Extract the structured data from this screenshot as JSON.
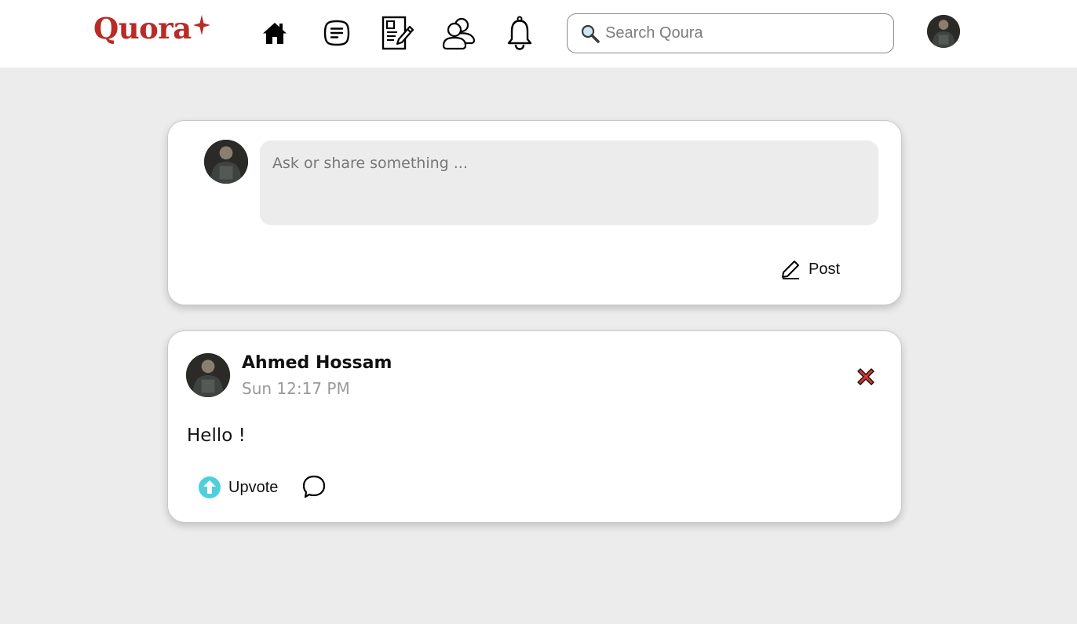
{
  "header": {
    "logo_text": "Quora",
    "nav_icons": [
      "home-icon",
      "answers-icon",
      "write-icon",
      "people-icon",
      "bell-icon"
    ],
    "search": {
      "placeholder": "Search Qoura",
      "value": ""
    },
    "brand_color": "#b92b27"
  },
  "composer": {
    "placeholder": "Ask or share something ...",
    "post_label": "Post"
  },
  "post": {
    "author": "Ahmed Hossam",
    "time": "Sun 12:17 PM",
    "text": "Hello !",
    "upvote_label": "Upvote",
    "upvote_color": "#4ecfdc",
    "delete_color": "#d9342b"
  }
}
